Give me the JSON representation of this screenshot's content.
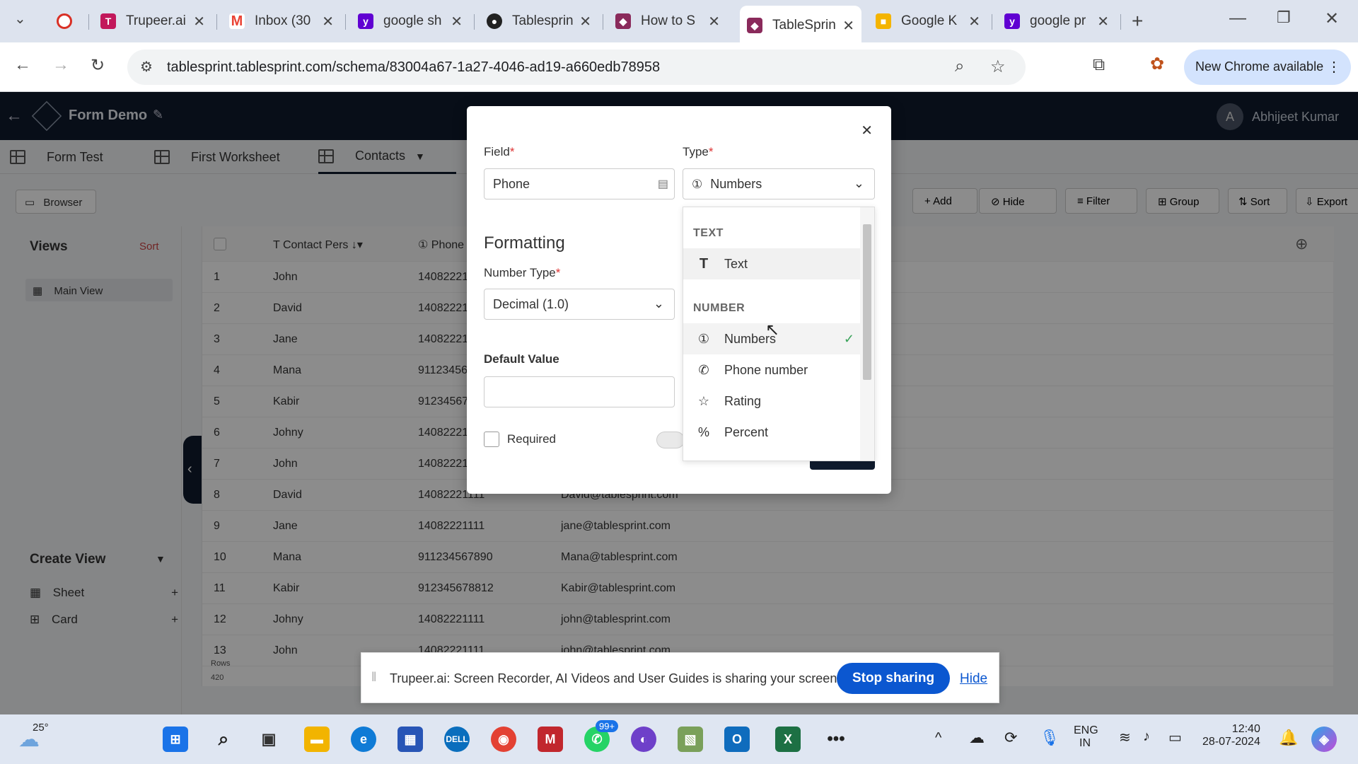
{
  "browser": {
    "tabs": [
      {
        "label": "",
        "color": "#d93025"
      },
      {
        "label": "Trupeer.ai",
        "color": "#c2185b"
      },
      {
        "label": "Inbox (30",
        "color": "#ea4335"
      },
      {
        "label": "google sh",
        "color": "#6001d2"
      },
      {
        "label": "Tablesprin",
        "color": "#222222"
      },
      {
        "label": "How to S",
        "color": "#8a2a5b"
      },
      {
        "label": "TableSprin",
        "color": "#8a2a5b"
      },
      {
        "label": "Google K",
        "color": "#f4b400"
      },
      {
        "label": "google pr",
        "color": "#6001d2"
      }
    ],
    "url": "tablesprint.tablesprint.com/schema/83004a67-1a27-4046-ad19-a660edb78958",
    "update_label": "New Chrome available"
  },
  "app": {
    "title": "Form Demo",
    "user_initial": "A",
    "user_name": "Abhijeet Kumar",
    "sheets": [
      "Form Test",
      "First Worksheet",
      "Contacts"
    ],
    "browser_btn": "Browser",
    "toolbar": [
      "Add",
      "Hide",
      "Filter",
      "Group",
      "Sort",
      "Export"
    ]
  },
  "views": {
    "title": "Views",
    "sort_label": "Sort",
    "main_view": "Main View",
    "create_title": "Create View",
    "create_items": [
      "Sheet",
      "Card"
    ]
  },
  "table": {
    "col_contact": "Contact Pers",
    "col_phone": "Phone",
    "rows": [
      {
        "n": "1",
        "name": "John",
        "phone": "14082221",
        "email": ""
      },
      {
        "n": "2",
        "name": "David",
        "phone": "14082221",
        "email": ""
      },
      {
        "n": "3",
        "name": "Jane",
        "phone": "14082221",
        "email": ""
      },
      {
        "n": "4",
        "name": "Mana",
        "phone": "91123456",
        "email": ""
      },
      {
        "n": "5",
        "name": "Kabir",
        "phone": "91234567",
        "email": ""
      },
      {
        "n": "6",
        "name": "Johny",
        "phone": "14082221",
        "email": ""
      },
      {
        "n": "7",
        "name": "John",
        "phone": "14082221",
        "email": ""
      },
      {
        "n": "8",
        "name": "David",
        "phone": "14082221111",
        "email": "David@tablesprint.com"
      },
      {
        "n": "9",
        "name": "Jane",
        "phone": "14082221111",
        "email": "jane@tablesprint.com"
      },
      {
        "n": "10",
        "name": "Mana",
        "phone": "911234567890",
        "email": "Mana@tablesprint.com"
      },
      {
        "n": "11",
        "name": "Kabir",
        "phone": "912345678812",
        "email": "Kabir@tablesprint.com"
      },
      {
        "n": "12",
        "name": "Johny",
        "phone": "14082221111",
        "email": "john@tablesprint.com"
      },
      {
        "n": "13",
        "name": "John",
        "phone": "14082221111",
        "email": "john@tablesprint.com"
      }
    ],
    "rows_label": "Rows",
    "rows_count": "420"
  },
  "modal": {
    "field_label": "Field",
    "field_value": "Phone",
    "type_label": "Type",
    "type_value": "Numbers",
    "formatting_title": "Formatting",
    "number_type_label": "Number Type",
    "number_type_value": "Decimal (1.0)",
    "default_value_label": "Default Value",
    "default_value": "",
    "required_label": "Required"
  },
  "dropdown": {
    "group_text": "TEXT",
    "group_number": "NUMBER",
    "items": [
      {
        "label": "Text",
        "icon": "T"
      },
      {
        "label": "Numbers",
        "icon": "①"
      },
      {
        "label": "Phone number",
        "icon": "✆"
      },
      {
        "label": "Rating",
        "icon": "☆"
      },
      {
        "label": "Percent",
        "icon": "%"
      }
    ]
  },
  "share": {
    "message": "Trupeer.ai: Screen Recorder, AI Videos and User Guides is sharing your screen.",
    "stop_label": "Stop sharing",
    "hide_label": "Hide"
  },
  "taskbar": {
    "weather": "25°",
    "badge": "99+",
    "lang1": "ENG",
    "lang2": "IN",
    "time": "12:40",
    "date": "28-07-2024"
  }
}
